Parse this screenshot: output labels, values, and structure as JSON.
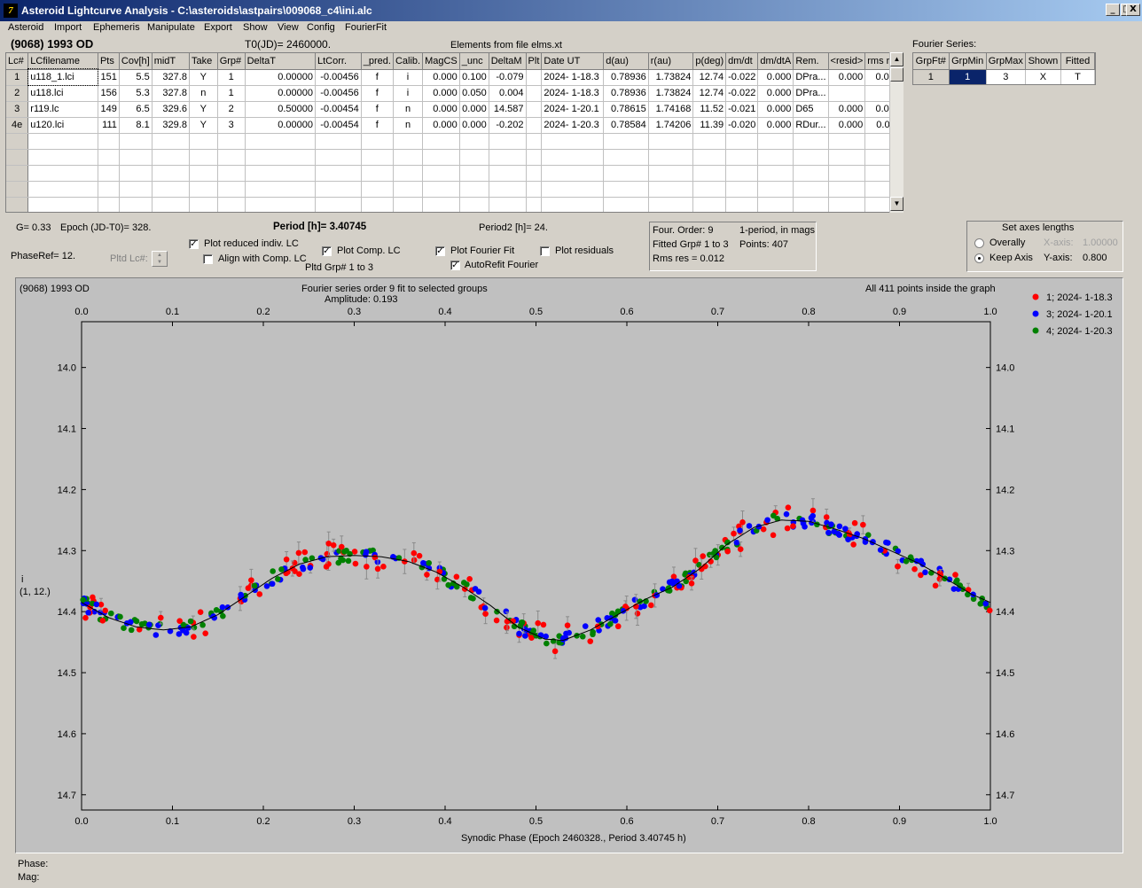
{
  "window": {
    "title": "Asteroid Lightcurve Analysis - C:\\asteroids\\astpairs\\009068_c4\\ini.alc",
    "app_icon": "7-italic-icon",
    "minimize": "_",
    "maximize": "□",
    "close": "X"
  },
  "menu": [
    "Asteroid",
    "Import",
    "Ephemeris",
    "Manipulate",
    "Export",
    "Show",
    "View",
    "Config",
    "FourierFit"
  ],
  "header": {
    "asteroid": "(9068) 1993 OD",
    "t0": "T0(JD)= 2460000.",
    "elements": "Elements from file elms.xt",
    "fourier_series_label": "Fourier Series:"
  },
  "lc_table": {
    "columns": [
      "Lc#",
      "LCfilename",
      "Pts",
      "Cov[h]",
      "midT",
      "Take",
      "Grp#",
      "DeltaT",
      "LtCorr.",
      "_pred.",
      "Calib.",
      "MagCS",
      "_unc",
      "DeltaM",
      "Plt",
      "Date UT",
      "d(au)",
      "r(au)",
      "p(deg)",
      "dm/dt",
      "dm/dtA",
      "Rem.",
      "<resid>",
      "rms res"
    ],
    "rows": [
      [
        "1",
        "u118_1.lci",
        "151",
        "5.5",
        "327.8",
        "Y",
        "1",
        "0.00000",
        "-0.00456",
        "f",
        "i",
        "0.000",
        "0.100",
        "-0.079",
        "",
        "2024- 1-18.3",
        "0.78936",
        "1.73824",
        "12.74",
        "-0.022",
        "0.000",
        "DPra...",
        "0.000",
        "0.016"
      ],
      [
        "2",
        "u118.lci",
        "156",
        "5.3",
        "327.8",
        "n",
        "1",
        "0.00000",
        "-0.00456",
        "f",
        "i",
        "0.000",
        "0.050",
        "0.004",
        "",
        "2024- 1-18.3",
        "0.78936",
        "1.73824",
        "12.74",
        "-0.022",
        "0.000",
        "DPra...",
        "",
        ""
      ],
      [
        "3",
        "r119.lc",
        "149",
        "6.5",
        "329.6",
        "Y",
        "2",
        "0.50000",
        "-0.00454",
        "f",
        "n",
        "0.000",
        "0.000",
        "14.587",
        "",
        "2024- 1-20.1",
        "0.78615",
        "1.74168",
        "11.52",
        "-0.021",
        "0.000",
        "D65",
        "0.000",
        "0.007"
      ],
      [
        "4e",
        "u120.lci",
        "111",
        "8.1",
        "329.8",
        "Y",
        "3",
        "0.00000",
        "-0.00454",
        "f",
        "n",
        "0.000",
        "0.000",
        "-0.202",
        "",
        "2024- 1-20.3",
        "0.78584",
        "1.74206",
        "11.39",
        "-0.020",
        "0.000",
        "RDur...",
        "0.000",
        "0.011"
      ]
    ],
    "empty_rows": 5
  },
  "fourier_table": {
    "columns": [
      "GrpFt#",
      "GrpMin",
      "GrpMax",
      "Shown",
      "Fitted"
    ],
    "rows": [
      [
        "1",
        "1",
        "3",
        "X",
        "T"
      ]
    ]
  },
  "params": {
    "g": "G= 0.33",
    "epoch": "Epoch (JD-T0)= 328.",
    "period": "Period [h]= 3.40745",
    "period2": "Period2 [h]= 24.",
    "phaseref": "PhaseRef= 12.",
    "pltd_lc": "Pltd Lc#:",
    "plot_reduced": "Plot reduced indiv. LC",
    "align_comp": "Align with Comp. LC",
    "plot_comp": "Plot Comp. LC",
    "pltd_grp": "Pltd Grp#  1   to   3",
    "plot_fourier": "Plot Fourier Fit",
    "autorefit": "AutoRefit Fourier",
    "plot_residuals": "Plot residuals",
    "checks": {
      "plot_reduced": true,
      "align_comp": false,
      "plot_comp": true,
      "plot_fourier": true,
      "autorefit": true,
      "plot_residuals": false
    }
  },
  "fourier_info": {
    "order": "Four. Order:  9",
    "mode": "1-period, in mags",
    "fitted": "Fitted Grp# 1 to 3",
    "points": "Points: 407",
    "rms": "Rms res     = 0.012"
  },
  "axes_panel": {
    "title": "Set axes lengths",
    "overally": "Overally",
    "keep_axis": "Keep Axis",
    "xaxis_label": "X-axis:",
    "xaxis_value": "1.00000",
    "yaxis_label": "Y-axis:",
    "yaxis_value": "0.800",
    "selected": "keep_axis"
  },
  "plot": {
    "object": "(9068) 1993 OD",
    "title": "Fourier series order 9 fit to selected groups",
    "amplitude": "Amplitude: 0.193",
    "inside": "All 411 points inside the graph",
    "ylabel_line1": "i",
    "ylabel_line2": "(1, 12.)",
    "xlabel": "Synodic Phase (Epoch 2460328., Period 3.40745 h)"
  },
  "footer": {
    "phase": "Phase:",
    "mag": "Mag:"
  },
  "chart_data": {
    "type": "scatter",
    "title": "Fourier series order 9 fit to selected groups",
    "xlabel": "Synodic Phase (Epoch 2460328., Period 3.40745 h)",
    "ylabel": "i",
    "xlim": [
      0.0,
      1.0
    ],
    "ylim": [
      14.725,
      13.925
    ],
    "y_inverted": true,
    "x_ticks": [
      "0.0",
      "0.1",
      "0.2",
      "0.3",
      "0.4",
      "0.5",
      "0.6",
      "0.7",
      "0.8",
      "0.9",
      "1.0"
    ],
    "y_ticks": [
      "14.0",
      "14.1",
      "14.2",
      "14.3",
      "14.4",
      "14.5",
      "14.6",
      "14.7"
    ],
    "legend_position": "top-right",
    "series": [
      {
        "name": "1; 2024- 1-18.3",
        "color": "#ff0000"
      },
      {
        "name": "3; 2024- 1-20.1",
        "color": "#0000ff"
      },
      {
        "name": "4; 2024- 1-20.3",
        "color": "#008000"
      }
    ],
    "fit_curve": {
      "color": "#000000",
      "x": [
        0.0,
        0.03,
        0.06,
        0.09,
        0.12,
        0.15,
        0.18,
        0.21,
        0.24,
        0.27,
        0.3,
        0.33,
        0.36,
        0.39,
        0.42,
        0.45,
        0.48,
        0.51,
        0.53,
        0.56,
        0.59,
        0.62,
        0.65,
        0.68,
        0.71,
        0.74,
        0.77,
        0.8,
        0.83,
        0.86,
        0.89,
        0.92,
        0.95,
        0.98,
        1.0
      ],
      "y": [
        14.385,
        14.41,
        14.425,
        14.43,
        14.425,
        14.405,
        14.375,
        14.345,
        14.322,
        14.31,
        14.308,
        14.31,
        14.318,
        14.335,
        14.36,
        14.39,
        14.425,
        14.445,
        14.447,
        14.43,
        14.405,
        14.38,
        14.36,
        14.33,
        14.29,
        14.262,
        14.25,
        14.252,
        14.265,
        14.28,
        14.3,
        14.32,
        14.345,
        14.372,
        14.385
      ]
    },
    "points": {
      "note": "individual observations scatter around the fit curve; color by series",
      "count": 411
    }
  }
}
